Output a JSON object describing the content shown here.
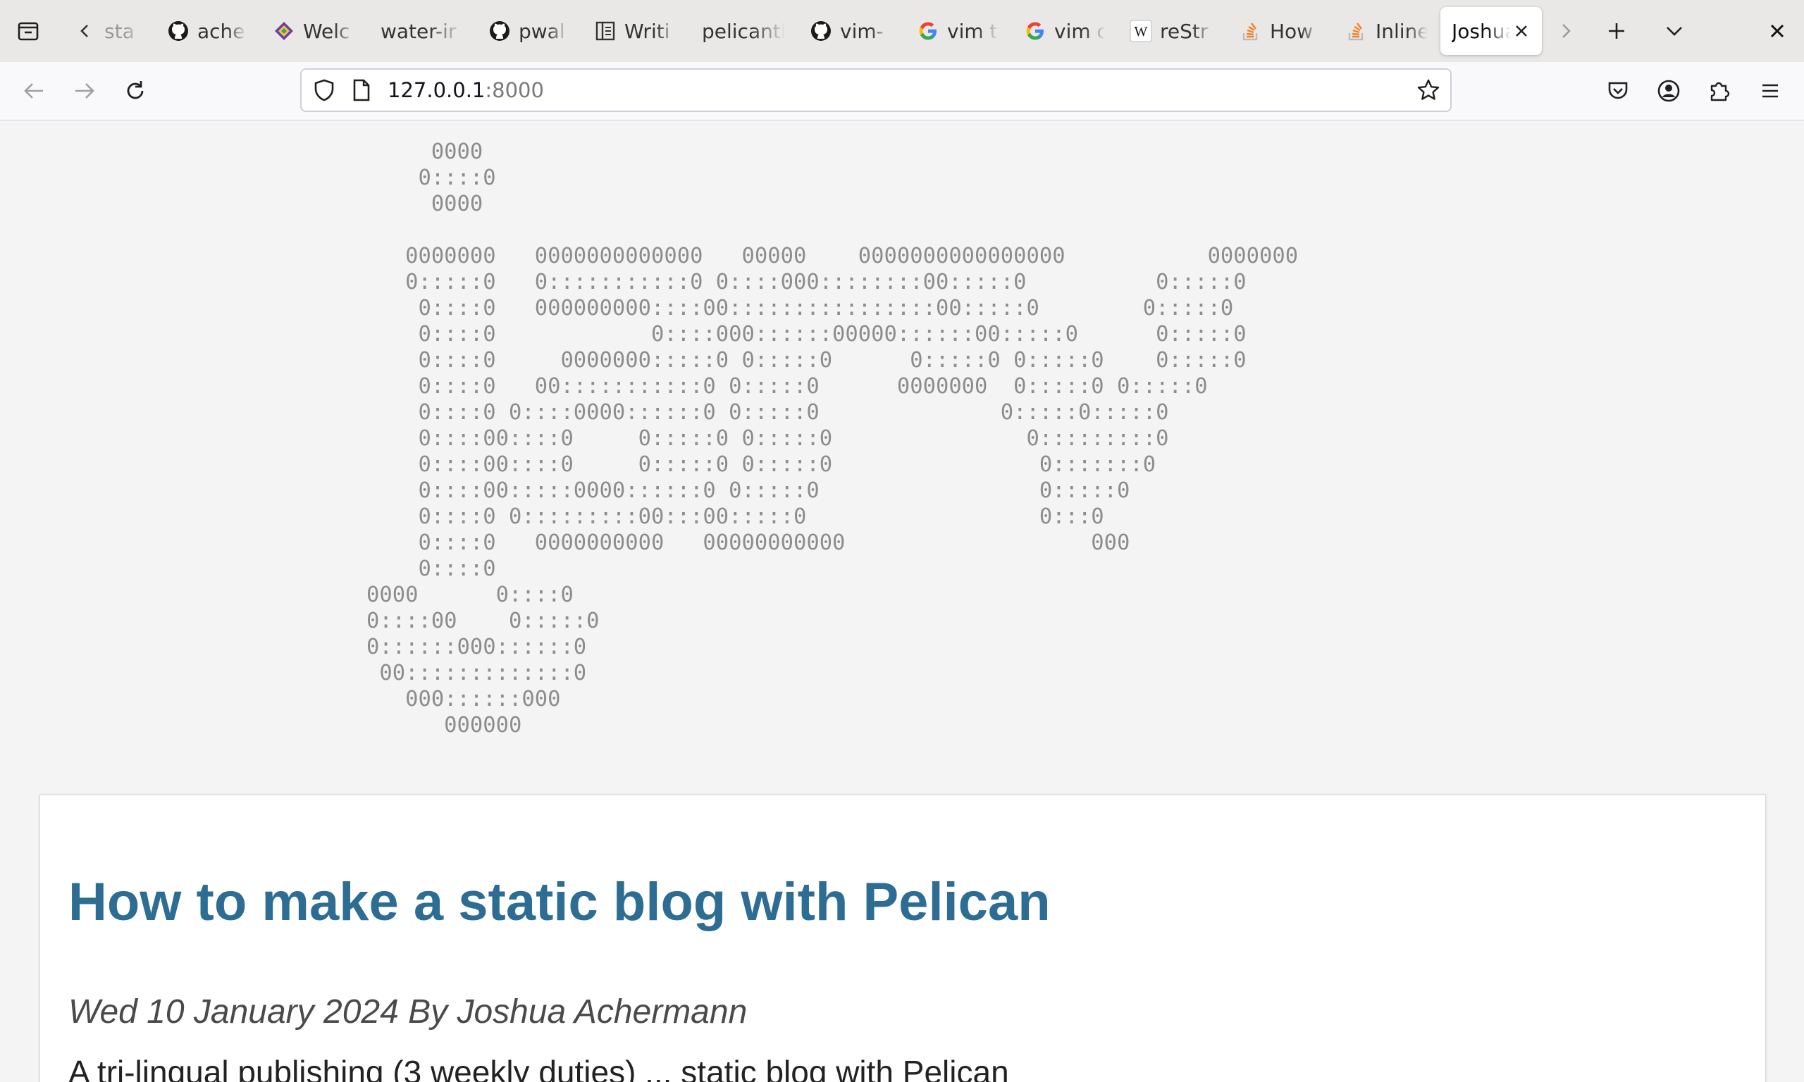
{
  "tabbar": {
    "tabs": [
      {
        "icon": "back-arrow-icon",
        "label": "sta"
      },
      {
        "icon": "github-icon",
        "label": "ache"
      },
      {
        "icon": "kite-logo-icon",
        "label": "Welc"
      },
      {
        "icon": "none",
        "label": "water-ir"
      },
      {
        "icon": "github-icon",
        "label": "pwal"
      },
      {
        "icon": "document-icon",
        "label": "Writi"
      },
      {
        "icon": "none",
        "label": "pelicantl"
      },
      {
        "icon": "github-icon",
        "label": "vim-"
      },
      {
        "icon": "google-icon",
        "label": "vim t"
      },
      {
        "icon": "google-icon",
        "label": "vim c"
      },
      {
        "icon": "wikipedia-icon",
        "label": "reStr"
      },
      {
        "icon": "stackoverflow-icon",
        "label": "How"
      },
      {
        "icon": "stackoverflow-icon",
        "label": "Inline"
      }
    ],
    "active_tab": {
      "label": "Joshua",
      "close_icon": "close-icon"
    }
  },
  "navbar": {
    "url_host": "127.0.0.1",
    "url_port": ":8000"
  },
  "page": {
    "ascii_art": "     0000\n    0::::0\n     0000\n\n   0000000   0000000000000   00000    0000000000000000           0000000\n   0:::::0   0:::::::::::0 0::::000::::::::00:::::0          0:::::0\n    0::::0   000000000::::00::::::::::::::::00:::::0        0:::::0\n    0::::0            0::::000::::::00000::::::00:::::0      0:::::0\n    0::::0     0000000:::::0 0:::::0      0:::::0 0:::::0    0:::::0\n    0::::0   00:::::::::::0 0:::::0      0000000  0:::::0 0:::::0\n    0::::0 0::::0000::::::0 0:::::0              0:::::0:::::0\n    0::::00::::0     0:::::0 0:::::0               0:::::::::0\n    0::::00::::0     0:::::0 0:::::0                0:::::::0\n    0::::00:::::0000::::::0 0:::::0                 0:::::0\n    0::::0 0:::::::::00:::00:::::0                  0:::0\n    0::::0   0000000000   00000000000                   000\n    0::::0\n0000      0::::0\n0::::00    0:::::0\n0::::::000::::::0\n 00:::::::::::::0\n   000::::::000\n      000000",
    "article": {
      "title": "How to make a static blog with Pelican",
      "meta": "Wed 10 January 2024 By Joshua Achermann",
      "excerpt": "A tri-lingual publishing (3 weekly duties) ... static blog with Pelican"
    }
  }
}
